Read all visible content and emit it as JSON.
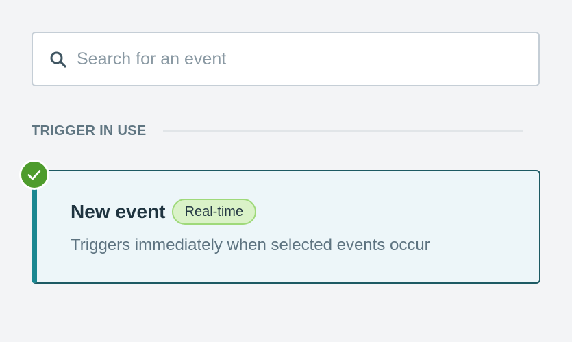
{
  "search": {
    "placeholder": "Search for an event",
    "value": "",
    "icon": "search-icon"
  },
  "section": {
    "title": "TRIGGER IN USE"
  },
  "trigger": {
    "title": "New event",
    "badge": "Real-time",
    "description": "Triggers immediately when selected events occur",
    "status_icon": "check-circle-icon",
    "selected": true
  },
  "colors": {
    "background": "#f3f4f6",
    "card_background": "#edf6f9",
    "card_accent": "#1a8791",
    "badge_background": "#daf2c8",
    "badge_border": "#9fd97a",
    "check_green": "#4e9c2d"
  }
}
